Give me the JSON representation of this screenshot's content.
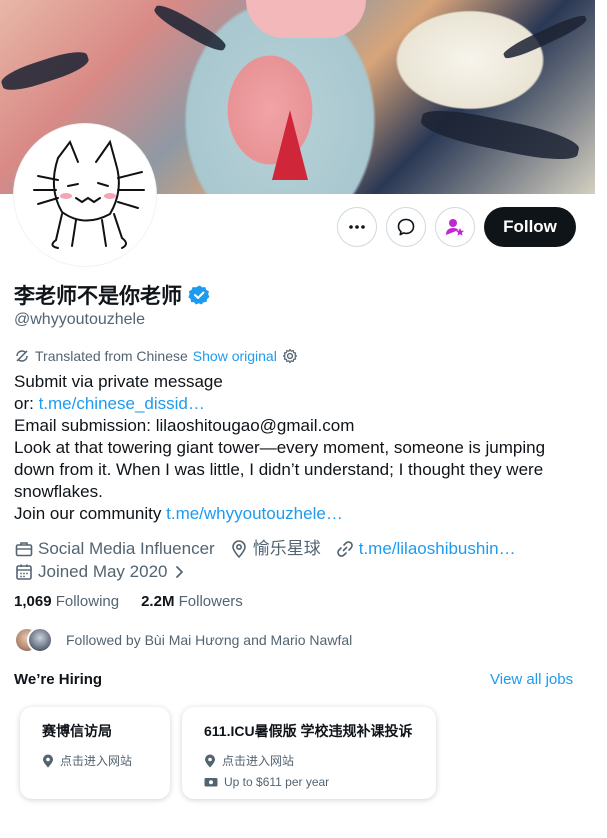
{
  "profile": {
    "name": "李老师不是你老师",
    "handle": "@whyyoutouzhele",
    "follow_label": "Follow"
  },
  "translation": {
    "label": "Translated from Chinese",
    "show_original": "Show original"
  },
  "bio": {
    "line1": "Submit via private message",
    "line2_prefix": "or: ",
    "line2_link": "t.me/chinese_dissid…",
    "line3": "Email submission: lilaoshitougao@gmail.com",
    "line4": "Look at that towering giant tower—every moment, someone is jumping",
    "line5": "down from it. When I was little, I didn’t understand; I thought they were",
    "line6": "snowflakes.",
    "line7_prefix": "Join our community ",
    "line7_link": "t.me/whyyoutouzhele…"
  },
  "meta": {
    "category": "Social Media Influencer",
    "location": "愉乐星球",
    "website": "t.me/lilaoshibushin…",
    "joined": "Joined May 2020"
  },
  "stats": {
    "following_count": "1,069",
    "following_label": "Following",
    "followers_count": "2.2M",
    "followers_label": "Followers"
  },
  "followed_by": "Followed by Bùi Mai Hương and Mario Nawfal",
  "hiring": {
    "title": "We’re Hiring",
    "view_all": "View all jobs",
    "jobs": [
      {
        "title": "赛博信访局",
        "location": "点击进入网站"
      },
      {
        "title": "611.ICU暑假版 学校违规补课投诉",
        "location": "点击进入网站",
        "salary": "Up to $611 per year"
      }
    ]
  },
  "colors": {
    "accent": "#1d9bf0",
    "verified": "#1d9bf0",
    "primary_button": "#0f1419",
    "subscribe_icon": "#c026d3"
  },
  "icons": [
    "more-icon",
    "message-icon",
    "subscribe-icon",
    "verified-icon",
    "translate-icon",
    "settings-icon",
    "briefcase-icon",
    "location-icon",
    "link-icon",
    "calendar-icon",
    "chevron-right-icon",
    "map-pin-icon",
    "money-icon"
  ]
}
